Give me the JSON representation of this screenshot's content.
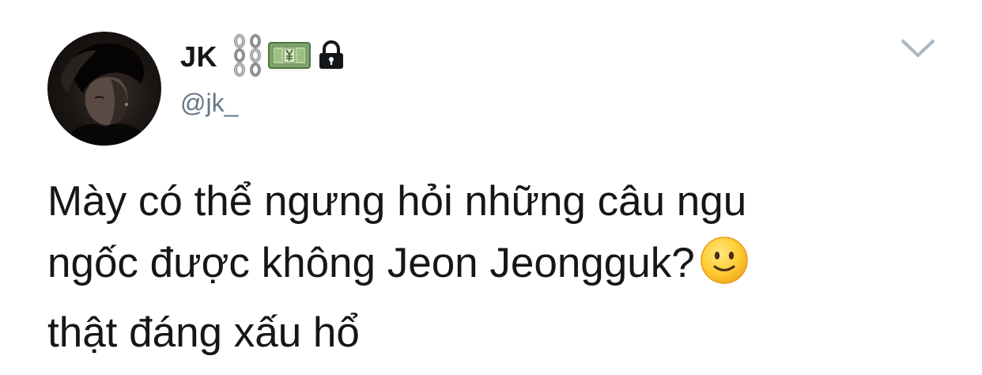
{
  "tweet": {
    "display_name": "JK",
    "handle": "@jk_",
    "name_emojis": [
      "chain-icon",
      "money-icon",
      "lock-icon"
    ],
    "text_lines": [
      "Mày có thể ngưng hỏi những câu ngu",
      "ngốc được không Jeon Jeongguk?",
      "thật đáng xấu hổ"
    ],
    "inline_emoji": "slightly-smiling-face-icon"
  },
  "colors": {
    "text": "#14171a",
    "secondary": "#657786",
    "caret": "#aab8c2",
    "background": "#ffffff"
  }
}
